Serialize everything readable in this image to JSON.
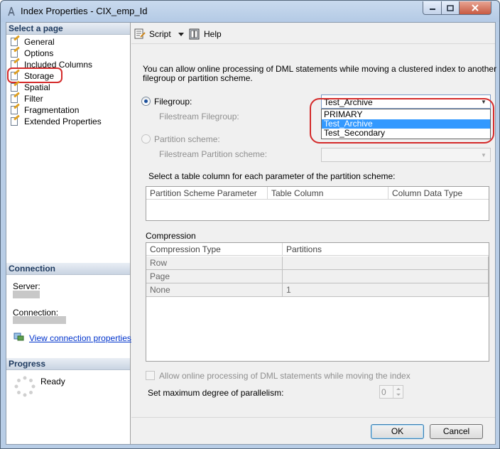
{
  "window": {
    "title": "Index Properties - CIX_emp_Id"
  },
  "left": {
    "select_page_header": "Select a page",
    "pages": [
      {
        "label": "General",
        "icon": "page-wand-icon"
      },
      {
        "label": "Options",
        "icon": "page-wand-icon"
      },
      {
        "label": "Included Columns",
        "icon": "page-wand-icon"
      },
      {
        "label": "Storage",
        "icon": "page-wand-icon"
      },
      {
        "label": "Spatial",
        "icon": "page-wand-icon"
      },
      {
        "label": "Filter",
        "icon": "page-wand-icon"
      },
      {
        "label": "Fragmentation",
        "icon": "page-wand-icon"
      },
      {
        "label": "Extended Properties",
        "icon": "page-wand-icon"
      }
    ],
    "connection_header": "Connection",
    "server_label": "Server:",
    "connection_label": "Connection:",
    "view_connection_link": "View connection properties",
    "progress_header": "Progress",
    "progress_status": "Ready"
  },
  "toolbar": {
    "script_label": "Script",
    "help_label": "Help"
  },
  "storage": {
    "info_line1": "You can allow online processing of DML statements while moving a clustered index to another",
    "info_line2": "filegroup or partition scheme.",
    "filegroup_label": "Filegroup:",
    "filegroup_value": "Test_Archive",
    "filegroup_options": [
      "PRIMARY",
      "Test_Archive",
      "Test_Secondary"
    ],
    "filegroup_selected_index": 1,
    "filestream_filegroup_label": "Filestream Filegroup:",
    "partition_scheme_label": "Partition scheme:",
    "filestream_partition_label": "Filestream Partition scheme:",
    "partition_params_caption": "Select a table column for each parameter of the partition scheme:",
    "partition_columns": [
      "Partition Scheme Parameter",
      "Table Column",
      "Column Data Type"
    ],
    "compression_label": "Compression",
    "compression_columns": [
      "Compression Type",
      "Partitions"
    ],
    "compression_rows": [
      {
        "type": "Row",
        "partitions": ""
      },
      {
        "type": "Page",
        "partitions": ""
      },
      {
        "type": "None",
        "partitions": "1"
      }
    ],
    "allow_online_label": "Allow online processing of DML statements while moving the index",
    "maxdop_label": "Set maximum degree of parallelism:",
    "maxdop_value": "0"
  },
  "buttons": {
    "ok": "OK",
    "cancel": "Cancel"
  },
  "colors": {
    "highlight": "#3399ff",
    "annotation_red": "#d42a2a"
  }
}
